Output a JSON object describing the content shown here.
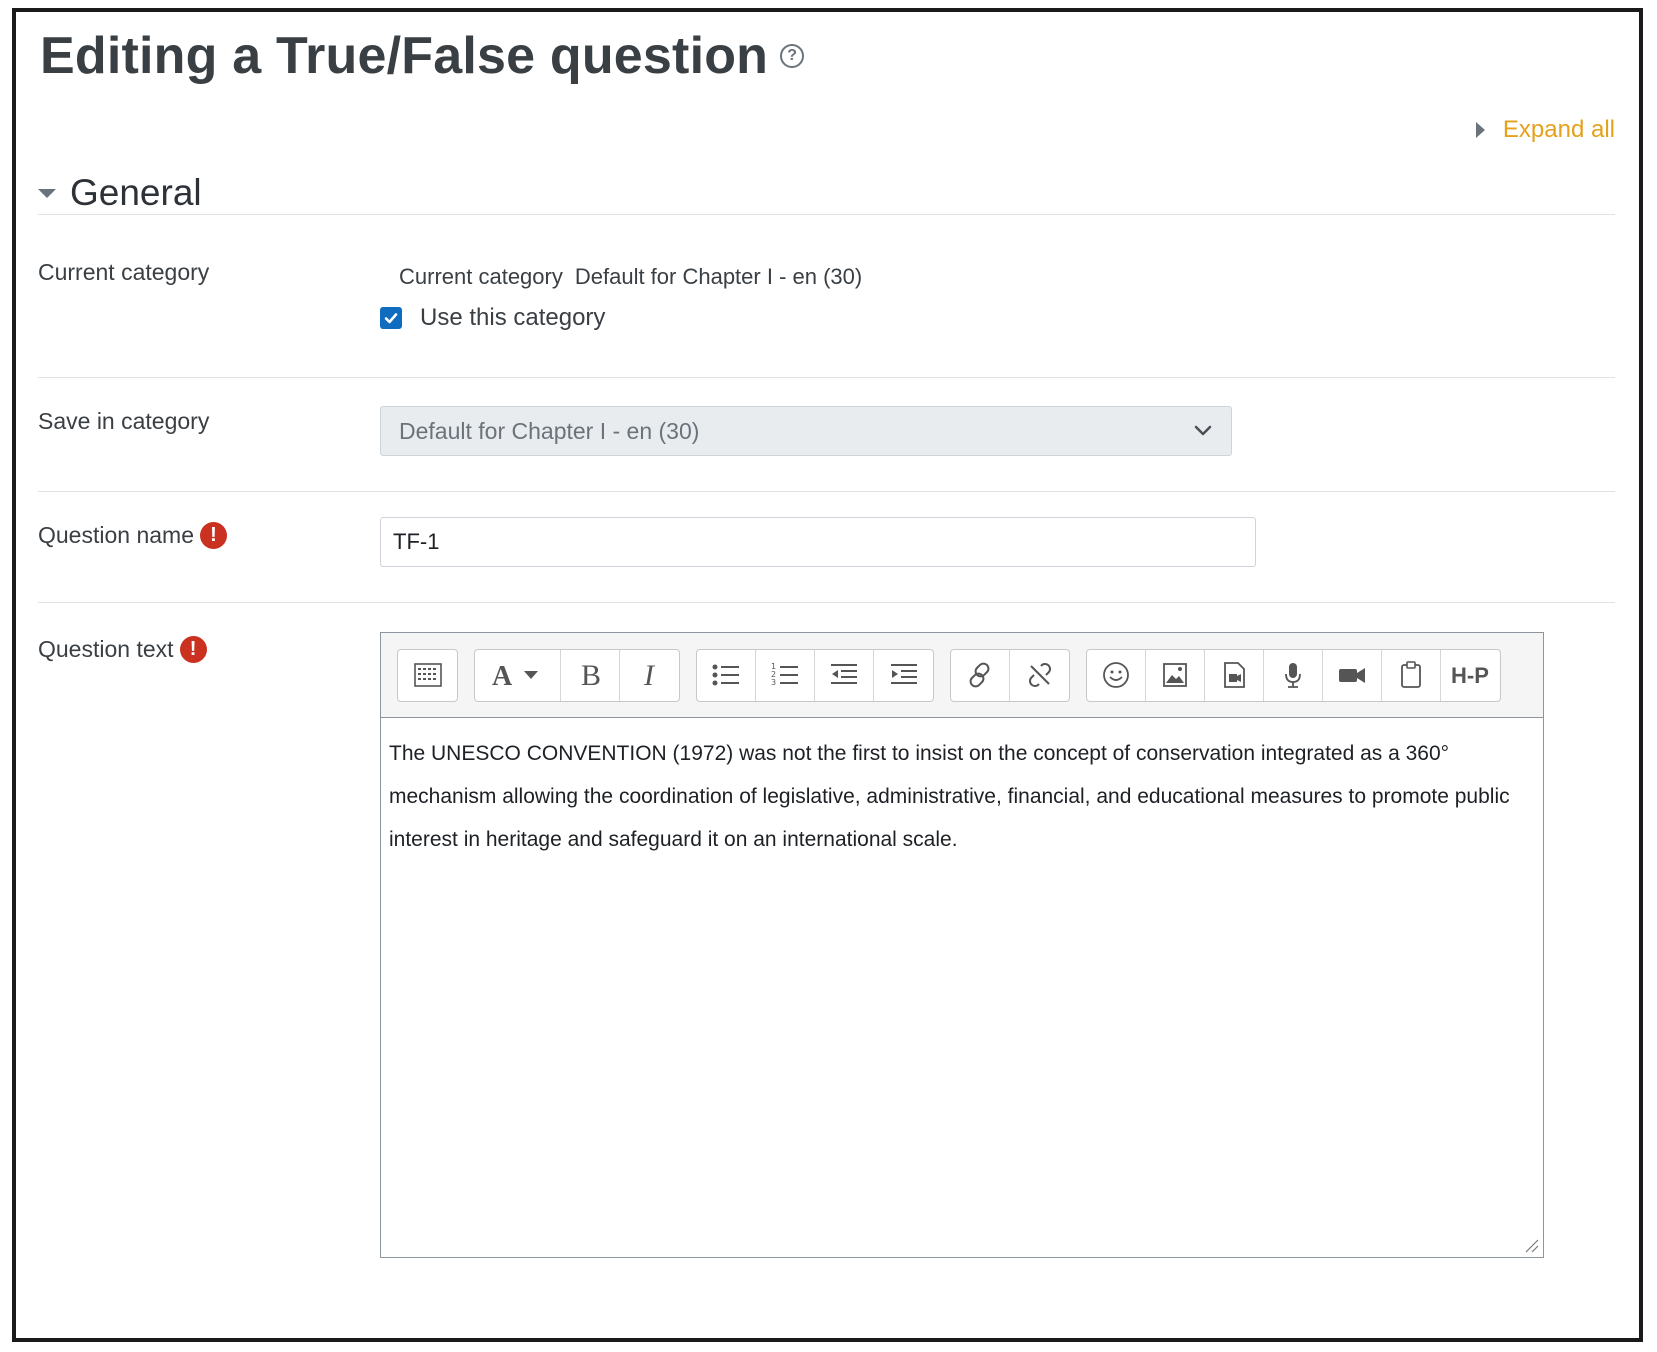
{
  "page": {
    "title": "Editing a True/False question",
    "help_icon": "question-circle-icon",
    "expand_all_label": "Expand all"
  },
  "section": {
    "title": "General"
  },
  "fields": {
    "current_category": {
      "label": "Current category",
      "inline_label": "Current category",
      "value": "Default for Chapter I - en (30)",
      "checkbox_label": "Use this category",
      "checkbox_checked": true
    },
    "save_in_category": {
      "label": "Save in category",
      "selected": "Default for Chapter I - en (30)"
    },
    "question_name": {
      "label": "Question name",
      "value": "TF-1",
      "required_icon": "exclamation-circle-icon"
    },
    "question_text": {
      "label": "Question text",
      "required_icon": "exclamation-circle-icon",
      "content": "The UNESCO CONVENTION (1972) was not the first to insist on the concept of conservation integrated as a 360° mechanism allowing the coordination of legislative, administrative, financial, and educational measures to promote public interest in heritage and safeguard it on an international scale."
    }
  },
  "toolbar": {
    "groups": [
      [
        "toolbar-toggle-icon"
      ],
      [
        "font-style-icon",
        "bold-icon",
        "italic-icon"
      ],
      [
        "unordered-list-icon",
        "ordered-list-icon",
        "outdent-icon",
        "indent-icon"
      ],
      [
        "link-icon",
        "unlink-icon"
      ],
      [
        "emoji-icon",
        "image-icon",
        "media-icon",
        "microphone-icon",
        "video-icon",
        "paste-icon",
        "h5p-icon"
      ]
    ],
    "h5p_label": "H-P"
  },
  "colors": {
    "accent_link": "#e4a11b",
    "required": "#ca3120",
    "checkbox": "#0f6cbf"
  }
}
